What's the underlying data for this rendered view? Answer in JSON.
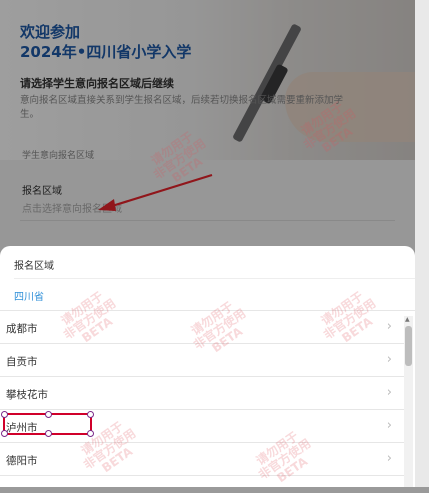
{
  "hero": {
    "title": "欢迎参加\n2024年•四川省小学入学",
    "subheading": "请选择学生意向报名区域后继续",
    "description": "意向报名区域直接关系到学生报名区域，后续若切换报名区域需要重新添加学生。"
  },
  "form": {
    "section_label": "学生意向报名区域",
    "field_label": "报名区域",
    "field_placeholder": "点击选择意向报名区域"
  },
  "picker": {
    "title": "报名区域",
    "province_tab": "四川省",
    "cities": [
      "成都市",
      "自贡市",
      "攀枝花市",
      "泸州市",
      "德阳市"
    ],
    "selected_city": "泸州市",
    "chevron": "›"
  },
  "watermark": "请勿用于\n非官方使用\nBETA",
  "colors": {
    "accent_blue": "#1e5aa8",
    "tab_blue": "#2f8fd8",
    "annotation_red": "#d0002a"
  }
}
